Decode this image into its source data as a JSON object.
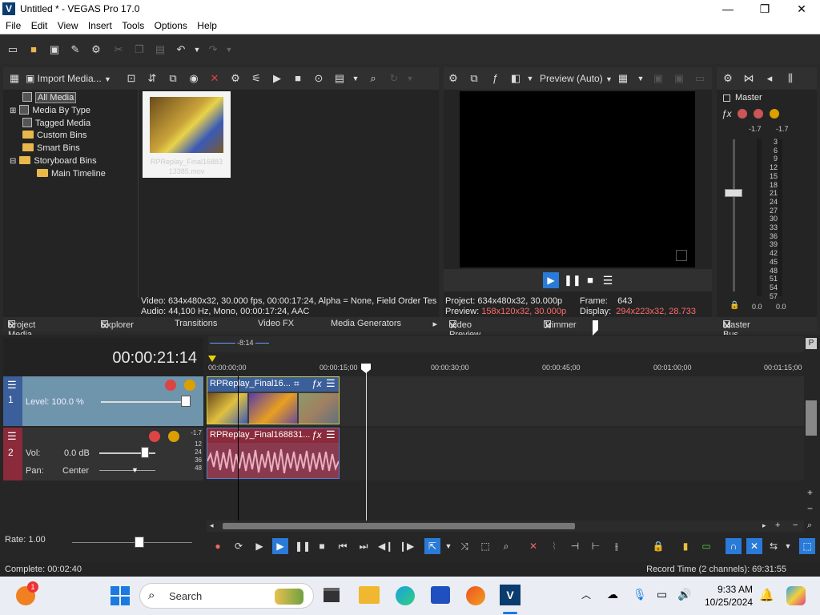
{
  "window": {
    "title": "Untitled * - VEGAS Pro 17.0",
    "logo": "V",
    "minimize": "—",
    "maximize": "❐",
    "close": "✕"
  },
  "menu": [
    "File",
    "Edit",
    "View",
    "Insert",
    "Tools",
    "Options",
    "Help"
  ],
  "project_media": {
    "import_label": "Import Media...",
    "tree": [
      "All Media",
      "Media By Type",
      "Tagged Media",
      "Custom Bins",
      "Smart Bins",
      "Storyboard Bins",
      "Main Timeline"
    ],
    "thumb_label": "RPReplay_Final16883 13385.mov",
    "info_video": "Video: 634x480x32, 30.000 fps, 00:00:17:24, Alpha = None, Field Order Tes",
    "info_audio": "Audio: 44,100 Hz, Mono, 00:00:17:24, AAC"
  },
  "preview": {
    "mode": "Preview (Auto)",
    "project_label": "Project:",
    "project_value": "634x480x32, 30.000p",
    "preview_label": "Preview:",
    "preview_value": "158x120x32, 30.000p",
    "frame_label": "Frame:",
    "frame_value": "643",
    "display_label": "Display:",
    "display_value": "294x223x32, 28.733"
  },
  "master": {
    "label": "Master",
    "peak_l": "-1.7",
    "peak_r": "-1.7",
    "scale": [
      "3",
      "6",
      "9",
      "12",
      "15",
      "18",
      "21",
      "24",
      "27",
      "30",
      "33",
      "36",
      "39",
      "42",
      "45",
      "48",
      "51",
      "54",
      "57"
    ],
    "fader_l": "0.0",
    "fader_r": "0.0"
  },
  "tabs": {
    "project_media": "Project Media",
    "explorer": "Explorer",
    "transitions": "Transitions",
    "video_fx": "Video FX",
    "media_generators": "Media Generators",
    "video_preview": "Video Preview",
    "trimmer": "Trimmer",
    "master_bus": "Master Bus"
  },
  "timeline": {
    "timecode": "00:00:21:14",
    "loop_len": "-8:14",
    "ruler": [
      "00:00:00;00",
      "00:00:15;00",
      "00:00:30;00",
      "00:00:45;00",
      "00:01:00;00",
      "00:01:15;00"
    ],
    "track1": {
      "num": "1",
      "level": "Level: 100.0 %",
      "clip": "RPReplay_Final16..."
    },
    "track2": {
      "num": "2",
      "vol_label": "Vol:",
      "vol_value": "0.0 dB",
      "pan_label": "Pan:",
      "pan_value": "Center",
      "clip": "RPReplay_Final168831...",
      "db": [
        "-1.7",
        "12",
        "24",
        "36",
        "48"
      ]
    },
    "rate": "Rate: 1.00"
  },
  "status": {
    "left": "Complete: 00:02:40",
    "right": "Record Time (2 channels): 69:31:55"
  },
  "taskbar": {
    "search": "Search",
    "time": "9:33 AM",
    "date": "10/25/2024",
    "badge": "1"
  }
}
